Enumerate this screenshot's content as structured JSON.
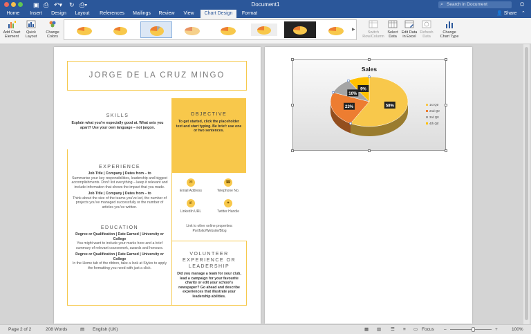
{
  "window": {
    "title": "Document1",
    "search_placeholder": "Search in Document"
  },
  "tabs": [
    {
      "label": "Home"
    },
    {
      "label": "Insert"
    },
    {
      "label": "Design"
    },
    {
      "label": "Layout"
    },
    {
      "label": "References"
    },
    {
      "label": "Mailings"
    },
    {
      "label": "Review"
    },
    {
      "label": "View"
    },
    {
      "label": "Chart Design"
    },
    {
      "label": "Format"
    }
  ],
  "share_label": "Share",
  "ribbon": {
    "add_chart_element": "Add Chart Element",
    "quick_layout": "Quick Layout",
    "change_colors": "Change Colors",
    "switch_row_column": "Switch Row/Column",
    "select_data": "Select Data",
    "edit_data_excel": "Edit Data in Excel",
    "refresh_data": "Refresh Data",
    "change_chart_type": "Change Chart Type"
  },
  "resume": {
    "name": "JORGE DE LA CRUZ MINGO",
    "skills_title": "SKILLS",
    "skills_text": "Explain what you're especially good at. What sets you apart? Use your own language – not jargon.",
    "objective_title": "OBJECTIVE",
    "objective_text": "To get started, click the placeholder text and start typing. Be brief: use one or two sentences.",
    "experience_title": "EXPERIENCE",
    "exp1_title": "Job Title | Company | Dates from – to",
    "exp1_text": "Summarise your key responsibilities, leadership and biggest accomplishments. Don't list everything – keep it relevant and include information that shows the impact that you made.",
    "exp2_title": "Job Title | Company | Dates from – to",
    "exp2_text": "Think about the size of the teams you've led, the number of projects you've managed successfully or the number of articles you've written.",
    "education_title": "EDUCATION",
    "edu1_title": "Degree or Qualification | Date Earned | University or College",
    "edu1_text": "You might want to include your marks here and a brief summary of relevant coursework, awards and honours.",
    "edu2_title": "Degree or Qualification | Date Earned | University or College",
    "edu2_text": "In the Home tab of the ribbon, take a look at Styles to apply the formatting you need with just a click.",
    "contact_email": "Email Address",
    "contact_phone": "Telephone No.",
    "contact_linkedin": "LinkedIn URL",
    "contact_twitter": "Twitter Handle",
    "links_text": "Link to other online properties: Portfolio/Website/Blog",
    "volunteer_title": "VOLUNTEER EXPERIENCE OR LEADERSHIP",
    "volunteer_text": "Did you manage a team for your club, lead a campaign for your favourite charity or edit your school's newspaper? Go ahead and describe experiences that illustrate your leadership abilities."
  },
  "chart_data": {
    "type": "pie",
    "title": "Sales",
    "categories": [
      "1st Qtr",
      "2nd Qtr",
      "3rd Qtr",
      "4th Qtr"
    ],
    "values": [
      58,
      23,
      10,
      9
    ],
    "labels": [
      "58%",
      "23%",
      "10%",
      "9%"
    ],
    "colors": [
      "#f8c84b",
      "#ed7d31",
      "#a5a5a5",
      "#ffc000"
    ],
    "legend": "right"
  },
  "status": {
    "page": "Page 2 of 2",
    "words": "208 Words",
    "language": "English (UK)",
    "focus": "Focus",
    "zoom": "100%"
  },
  "colors": {
    "word_blue": "#2b579a",
    "accent_yellow": "#f8c84b"
  }
}
